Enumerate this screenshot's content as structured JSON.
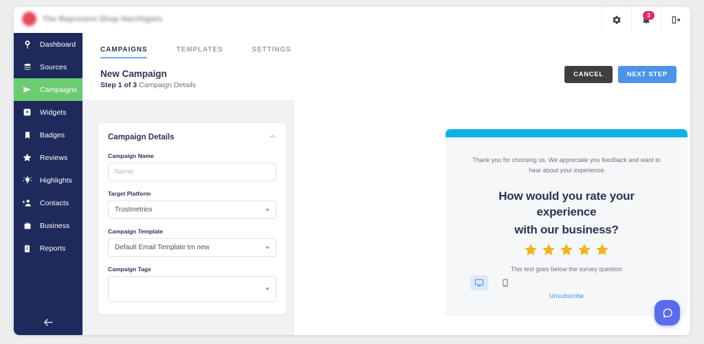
{
  "topbar": {
    "brand_name": "The Represent Shop Harchlgwis",
    "logo_icon": "circle-logo-redacted",
    "actions": [
      {
        "name": "settings-gear",
        "icon": "gear-icon"
      },
      {
        "name": "notifications",
        "icon": "bell-icon",
        "badge": "3"
      },
      {
        "name": "logout",
        "icon": "logout-icon"
      }
    ]
  },
  "sidebar": {
    "items": [
      {
        "label": "Dashboard",
        "icon": "dashboard-icon",
        "active": false
      },
      {
        "label": "Sources",
        "icon": "database-icon",
        "active": false
      },
      {
        "label": "Campaigns",
        "icon": "send-icon",
        "active": true
      },
      {
        "label": "Widgets",
        "icon": "widget-icon",
        "active": false
      },
      {
        "label": "Badges",
        "icon": "bookmark-icon",
        "active": false
      },
      {
        "label": "Reviews",
        "icon": "star-icon",
        "active": false
      },
      {
        "label": "Highlights",
        "icon": "lightbulb-icon",
        "active": false
      },
      {
        "label": "Contacts",
        "icon": "person-add-icon",
        "active": false
      },
      {
        "label": "Business",
        "icon": "briefcase-icon",
        "active": false
      },
      {
        "label": "Reports",
        "icon": "clipboard-icon",
        "active": false
      }
    ],
    "collapse_icon": "arrow-left-icon",
    "active_color": "#6ccc70",
    "background_color": "#1f2a5c"
  },
  "tabs": [
    {
      "label": "CAMPAIGNS",
      "active": true
    },
    {
      "label": "TEMPLATES",
      "active": false
    },
    {
      "label": "SETTINGS",
      "active": false
    }
  ],
  "header": {
    "title": "New Campaign",
    "step": "Step 1 of 3",
    "step_detail": "Campaign Details",
    "cancel_label": "CANCEL",
    "next_label": "NEXT STEP",
    "cancel_color": "#3f3f3f",
    "next_color": "#4d94e8"
  },
  "form": {
    "card_title": "Campaign Details",
    "collapse_icon": "chevron-up-icon",
    "fields": [
      {
        "label": "Campaign Name",
        "type": "text",
        "value": "",
        "placeholder": "Name"
      },
      {
        "label": "Target Platform",
        "type": "select",
        "value": "Trustmetrics",
        "placeholder": ""
      },
      {
        "label": "Campaign Template",
        "type": "select",
        "value": "Default Email Template tm new",
        "placeholder": ""
      },
      {
        "label": "Campaign Tags",
        "type": "select",
        "value": "",
        "placeholder": ""
      }
    ]
  },
  "preview": {
    "accent_bar_color": "#11b0e4",
    "intro_text": "Thank you for choosing us. We appreciate you feedback and want to hear about your experience",
    "question_line1": "How would you rate your experience",
    "question_line2": "with our business?",
    "star_count": 5,
    "star_color": "#efb51f",
    "below_text": "This text goes below the survey question",
    "unsubscribe_label": "Unsubscribe",
    "unsubscribe_color": "#3f92e8",
    "devices": [
      {
        "name": "desktop",
        "icon": "monitor-icon",
        "active": true
      },
      {
        "name": "mobile",
        "icon": "phone-icon",
        "active": false
      }
    ]
  },
  "chat": {
    "icon": "chat-bubble-icon",
    "color": "#5a6cea"
  }
}
